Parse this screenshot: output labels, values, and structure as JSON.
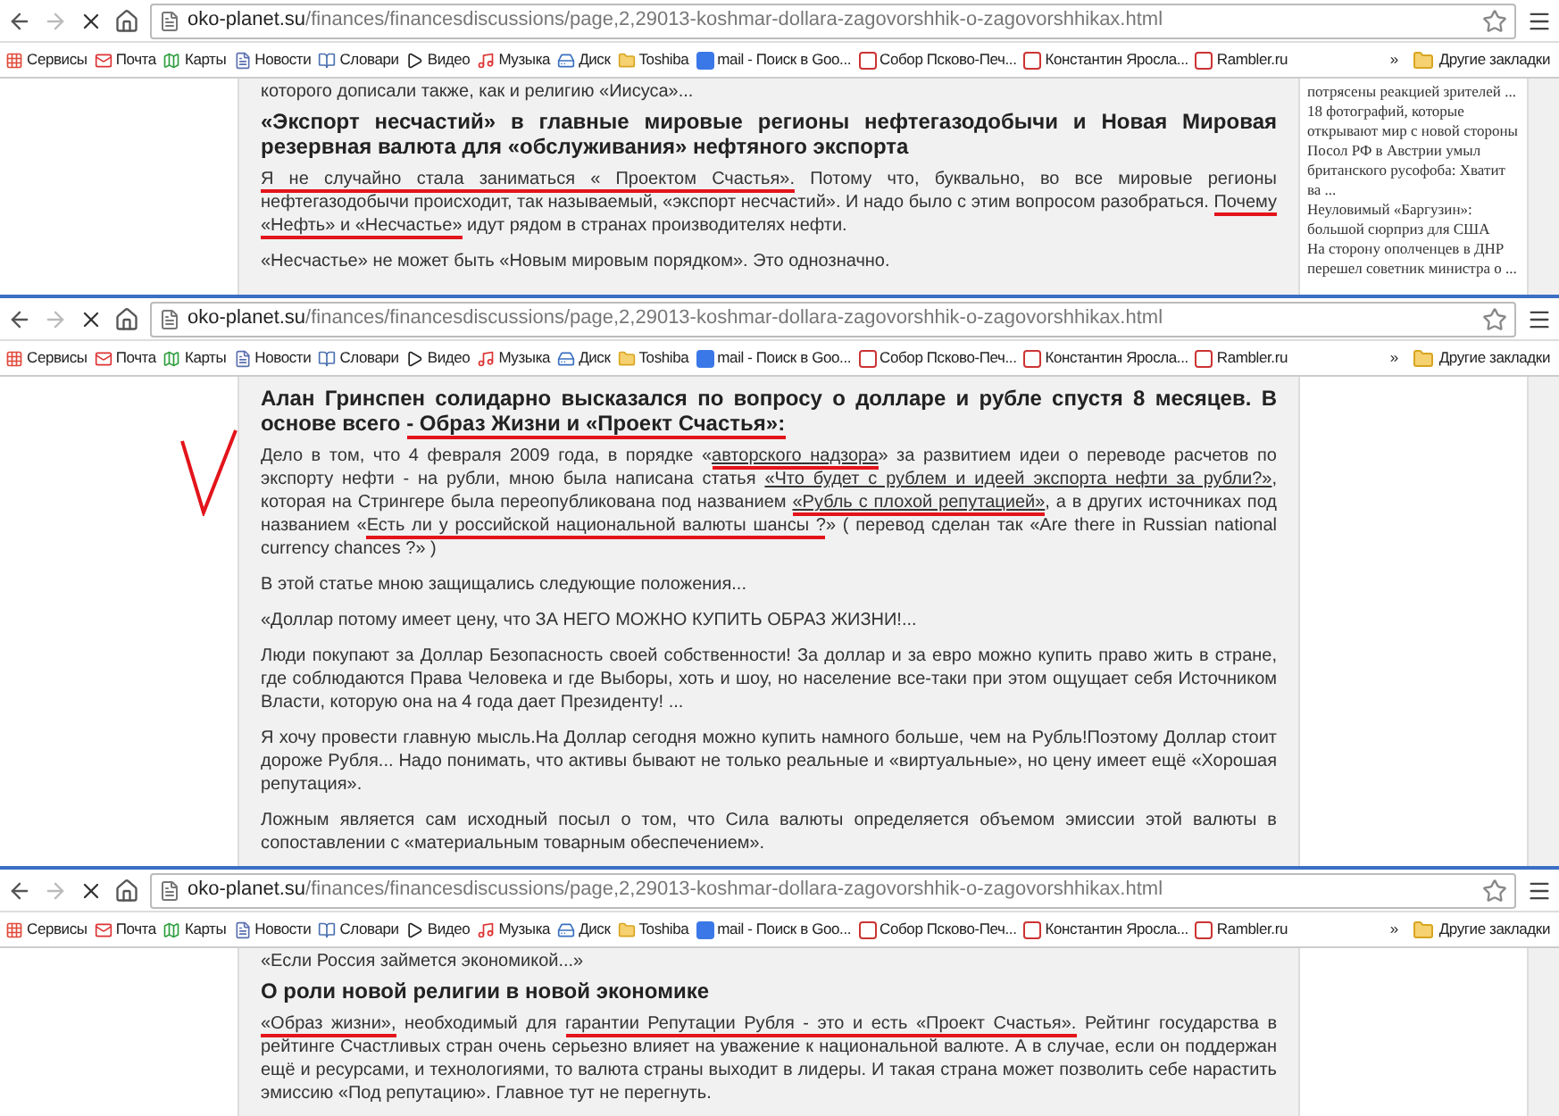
{
  "panels": [
    {
      "browser": {
        "url_host": "oko-planet.su",
        "url_path": "/finances/financesdiscussions/page,2,29013-koshmar-dollara-zagovorshhik-o-zagovorshhikax.html",
        "bookmarks": [
          {
            "label": "Сервисы",
            "kind": "apps"
          },
          {
            "label": "Почта",
            "kind": "mail"
          },
          {
            "label": "Карты",
            "kind": "maps"
          },
          {
            "label": "Новости",
            "kind": "page"
          },
          {
            "label": "Словари",
            "kind": "book"
          },
          {
            "label": "Видео",
            "kind": "video"
          },
          {
            "label": "Музыка",
            "kind": "music"
          },
          {
            "label": "Диск",
            "kind": "disk"
          },
          {
            "label": "Toshiba",
            "kind": "folder"
          },
          {
            "label": "mail - Поиск в Goo...",
            "kind": "google"
          },
          {
            "label": "Собор Псково-Печ...",
            "kind": "yandex"
          },
          {
            "label": "Константин Яросла...",
            "kind": "yandex"
          },
          {
            "label": "Rambler.ru",
            "kind": "yandex"
          }
        ],
        "overflow": "»",
        "other_bookmarks": "Другие закладки"
      },
      "blocks": [
        {
          "kind": "cut",
          "segments": [
            {
              "text": "которого дописали также, как и религию «Иисуса»...",
              "marked": false,
              "link": false
            }
          ]
        },
        {
          "kind": "heading",
          "segments": [
            {
              "text": "«Экспорт несчастий» в главные мировые регионы нефтегазодобычи и Новая Мировая резервная валюта для «обслуживания» нефтяного экспорта",
              "marked": false,
              "link": false
            }
          ]
        },
        {
          "kind": "paragraph",
          "segments": [
            {
              "text": "Я не случайно стала заниматься « Проектом Счастья».",
              "marked": true,
              "link": false
            },
            {
              "text": " Потому что, буквально, во все мировые регионы нефтегазодобычи происходит, так называемый, «экспорт несчастий». И надо было с этим вопросом разобраться. ",
              "marked": false,
              "link": false
            },
            {
              "text": "Почему «Нефть» и «Несчастье»",
              "marked": true,
              "link": false
            },
            {
              "text": " идут рядом в странах производителях нефти.",
              "marked": false,
              "link": false
            }
          ]
        },
        {
          "kind": "paragraph",
          "segments": [
            {
              "text": "«Несчастье» не может быть «Новым мировым порядком». Это однозначно.",
              "marked": false,
              "link": false
            }
          ]
        }
      ],
      "sidebar": [
        "потрясены реакцией зрителей ...",
        "18 фотографий, которые открывают мир с новой стороны",
        "Посол РФ в Австрии умыл британского русофоба: Хватит ва ...",
        "Неуловимый «Баргузин»: большой сюрприз для США",
        "На сторону ополченцев в ДНР перешел советник министра о ..."
      ],
      "check_mark": false
    },
    {
      "browser": {
        "url_host": "oko-planet.su",
        "url_path": "/finances/financesdiscussions/page,2,29013-koshmar-dollara-zagovorshhik-o-zagovorshhikax.html",
        "bookmarks": [
          {
            "label": "Сервисы",
            "kind": "apps"
          },
          {
            "label": "Почта",
            "kind": "mail"
          },
          {
            "label": "Карты",
            "kind": "maps"
          },
          {
            "label": "Новости",
            "kind": "page"
          },
          {
            "label": "Словари",
            "kind": "book"
          },
          {
            "label": "Видео",
            "kind": "video"
          },
          {
            "label": "Музыка",
            "kind": "music"
          },
          {
            "label": "Диск",
            "kind": "disk"
          },
          {
            "label": "Toshiba",
            "kind": "folder"
          },
          {
            "label": "mail - Поиск в Goo...",
            "kind": "google"
          },
          {
            "label": "Собор Псково-Печ...",
            "kind": "yandex"
          },
          {
            "label": "Константин Яросла...",
            "kind": "yandex"
          },
          {
            "label": "Rambler.ru",
            "kind": "yandex"
          }
        ],
        "overflow": "»",
        "other_bookmarks": "Другие закладки"
      },
      "blocks": [
        {
          "kind": "heading",
          "segments": [
            {
              "text": "Алан Гринспен солидарно высказался по вопросу о долларе и рубле спустя 8 месяцев. В основе всего ",
              "marked": false,
              "link": false
            },
            {
              "text": "- Образ Жизни и «Проект Счастья»:",
              "marked": true,
              "link": false
            }
          ]
        },
        {
          "kind": "paragraph",
          "segments": [
            {
              "text": "Дело в том, что 4 февраля 2009 года, в порядке «",
              "marked": false,
              "link": false
            },
            {
              "text": "авторского надзора",
              "marked": true,
              "link": true
            },
            {
              "text": "» за развитием идеи о переводе расчетов по экспорту нефти - на рубли, мною была написана статья ",
              "marked": false,
              "link": false
            },
            {
              "text": "«Что будет с рублем и идеей экспорта нефти за рубли?»",
              "marked": false,
              "link": true
            },
            {
              "text": ", которая на Стрингере была переопубликована под названием ",
              "marked": false,
              "link": false
            },
            {
              "text": "«Рубль с плохой репутацией»",
              "marked": true,
              "link": true
            },
            {
              "text": ", а в других источниках под названием «",
              "marked": false,
              "link": false
            },
            {
              "text": "Есть ли у российской национальной валюты шансы ?",
              "marked": true,
              "link": false
            },
            {
              "text": "» ( перевод сделан так «Are there in Russian national currency chances ?» )",
              "marked": false,
              "link": false
            }
          ]
        },
        {
          "kind": "paragraph",
          "segments": [
            {
              "text": "В этой статье мною защищались следующие положения...",
              "marked": false,
              "link": false
            }
          ]
        },
        {
          "kind": "paragraph",
          "segments": [
            {
              "text": "«Доллар потому имеет цену, что ЗА НЕГО МОЖНО КУПИТЬ ОБРАЗ ЖИЗНИ!...",
              "marked": false,
              "link": false
            }
          ]
        },
        {
          "kind": "paragraph",
          "segments": [
            {
              "text": "Люди покупают за Доллар Безопасность своей собственности! За доллар и за евро можно купить право жить в стране, где соблюдаются Права Человека и где Выборы, хоть и шоу, но население все-таки при этом ощущает себя Источником Власти, которую она на 4 года дает Президенту! ...",
              "marked": false,
              "link": false
            }
          ]
        },
        {
          "kind": "paragraph",
          "segments": [
            {
              "text": "Я хочу провести главную мысль.На Доллар сегодня можно купить намного больше, чем на Рубль!Поэтому Доллар стоит дороже Рубля... Надо понимать, что активы бывают не только реальные и «виртуальные», но цену имеет ещё «Хорошая репутация».",
              "marked": false,
              "link": false
            }
          ]
        },
        {
          "kind": "paragraph",
          "segments": [
            {
              "text": "Ложным является сам исходный посыл о том, что Сила валюты определяется объемом эмиссии этой валюты в сопоставлении с «материальным товарным обеспечением».",
              "marked": false,
              "link": false
            }
          ]
        }
      ],
      "check_mark": true
    },
    {
      "browser": {
        "url_host": "oko-planet.su",
        "url_path": "/finances/financesdiscussions/page,2,29013-koshmar-dollara-zagovorshhik-o-zagovorshhikax.html",
        "bookmarks": [
          {
            "label": "Сервисы",
            "kind": "apps"
          },
          {
            "label": "Почта",
            "kind": "mail"
          },
          {
            "label": "Карты",
            "kind": "maps"
          },
          {
            "label": "Новости",
            "kind": "page"
          },
          {
            "label": "Словари",
            "kind": "book"
          },
          {
            "label": "Видео",
            "kind": "video"
          },
          {
            "label": "Музыка",
            "kind": "music"
          },
          {
            "label": "Диск",
            "kind": "disk"
          },
          {
            "label": "Toshiba",
            "kind": "folder"
          },
          {
            "label": "mail - Поиск в Goo...",
            "kind": "google"
          },
          {
            "label": "Собор Псково-Печ...",
            "kind": "yandex"
          },
          {
            "label": "Константин Яросла...",
            "kind": "yandex"
          },
          {
            "label": "Rambler.ru",
            "kind": "yandex"
          }
        ],
        "overflow": "»",
        "other_bookmarks": "Другие закладки"
      },
      "blocks": [
        {
          "kind": "cut",
          "segments": [
            {
              "text": "«Если Россия займется экономикой...»",
              "marked": false,
              "link": false
            }
          ]
        },
        {
          "kind": "heading",
          "segments": [
            {
              "text": "О роли новой религии в новой экономике",
              "marked": false,
              "link": false
            }
          ]
        },
        {
          "kind": "paragraph",
          "segments": [
            {
              "text": "«Образ жизни»,",
              "marked": true,
              "link": false
            },
            {
              "text": " необходимый для ",
              "marked": false,
              "link": false
            },
            {
              "text": "гарантии Репутации Рубля - это и есть «Проект Счастья».",
              "marked": true,
              "link": false
            },
            {
              "text": " Рейтинг государства в рейтинге Счастливых стран очень серьезно влияет на уважение к национальной валюте. А в случае, если он поддержан ещё и ресурсами, и технологиями, то валюта страны выходит в лидеры. И такая страна может позволить себе нарастить эмиссию «Под репутацию». Главное тут не перегнуть.",
              "marked": false,
              "link": false
            }
          ]
        }
      ],
      "check_mark": false
    }
  ]
}
